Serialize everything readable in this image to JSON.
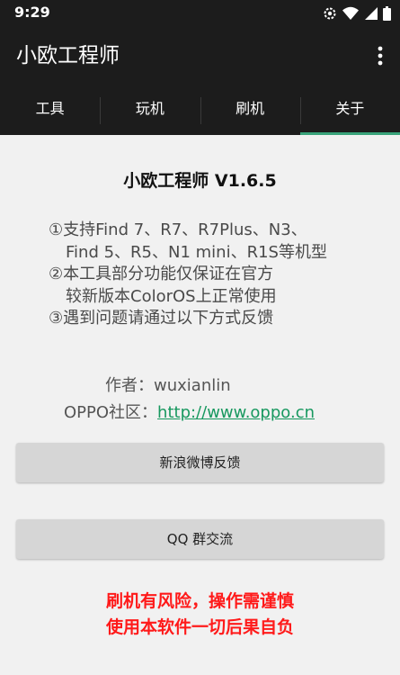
{
  "status_bar": {
    "time": "9:29",
    "icons": [
      "gear-icon",
      "wifi-icon",
      "signal-icon",
      "battery-icon"
    ]
  },
  "app_bar": {
    "title": "小欧工程师",
    "overflow_icon": "more-vert-icon"
  },
  "tabs": [
    {
      "label": "工具",
      "active": false
    },
    {
      "label": "玩机",
      "active": false
    },
    {
      "label": "刷机",
      "active": false
    },
    {
      "label": "关于",
      "active": true
    }
  ],
  "about": {
    "title": "小欧工程师 V1.6.5",
    "features": [
      "①支持Find 7、R7、R7Plus、N3、",
      "Find 5、R5、N1 mini、R1S等机型",
      "②本工具部分功能仅保证在官方",
      "较新版本ColorOS上正常使用",
      "③遇到问题请通过以下方式反馈"
    ],
    "author_label": "作者：",
    "author_name": "wuxianlin",
    "community_label": "OPPO社区：",
    "community_link": "http://www.oppo.cn",
    "weibo_button": "新浪微博反馈",
    "qq_button": "QQ 群交流",
    "warning_line1": "刷机有风险，操作需谨慎",
    "warning_line2": "使用本软件一切后果自负"
  },
  "colors": {
    "bar_background": "#1c1c1c",
    "tab_indicator": "#39a37a",
    "link": "#17985f",
    "warning": "#ff1a1a"
  }
}
